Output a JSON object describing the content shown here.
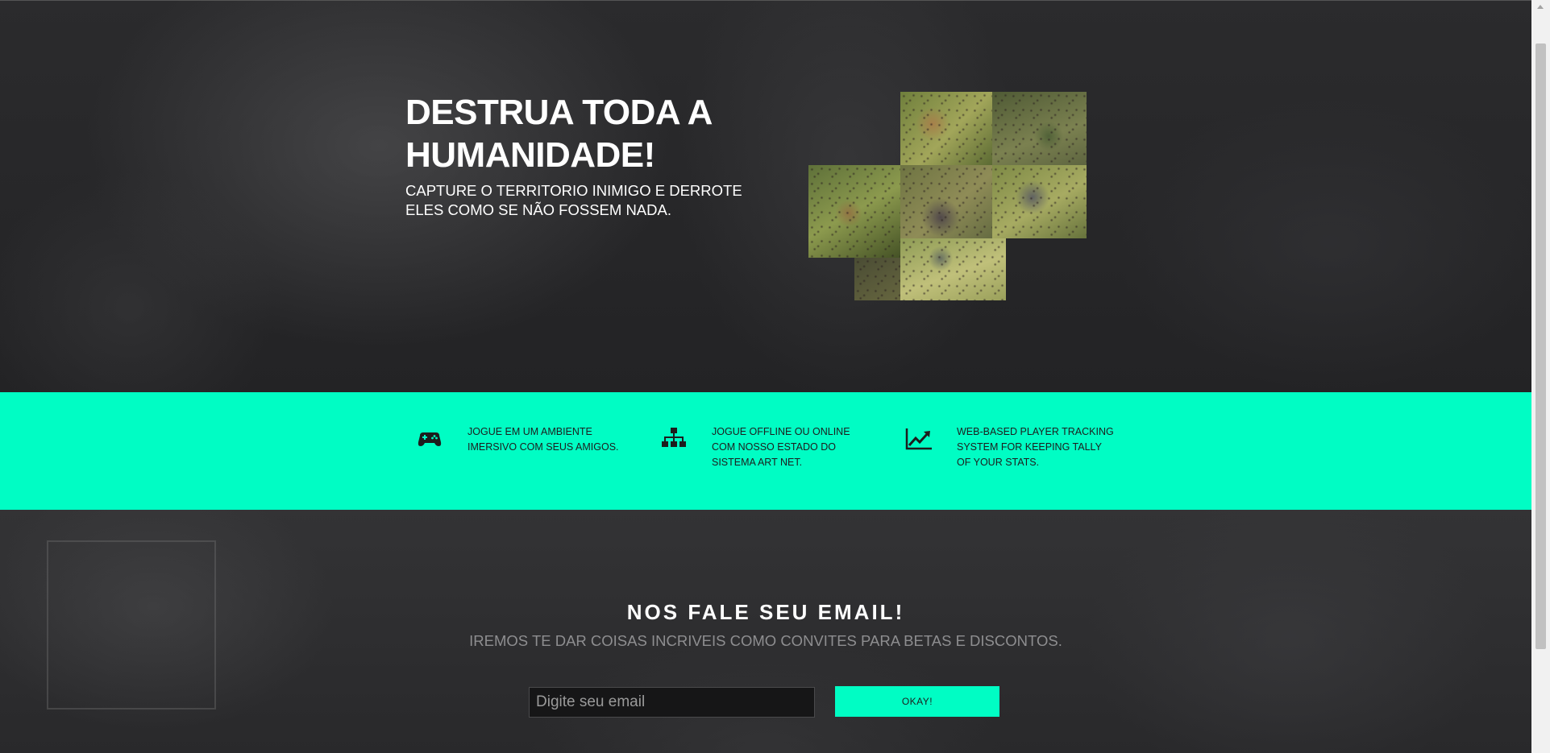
{
  "hero": {
    "title": "DESTRUA TODA A HUMANIDADE!",
    "subtitle": "CAPTURE O TERRITORIO INIMIGO E DERROTE ELES COMO SE NÃO FOSSEM NADA."
  },
  "features": [
    {
      "icon": "gamepad-icon",
      "text": "JOGUE EM UM AMBIENTE IMERSIVO COM SEUS AMIGOS."
    },
    {
      "icon": "sitemap-icon",
      "text": "JOGUE OFFLINE OU ONLINE COM NOSSO ESTADO DO SISTEMA ART NET."
    },
    {
      "icon": "line-chart-icon",
      "text": "WEB-BASED PLAYER TRACKING SYSTEM FOR KEEPING TALLY OF YOUR STATS."
    }
  ],
  "signup": {
    "title": "NOS FALE SEU EMAIL!",
    "subtitle": "IREMOS TE DAR COISAS INCRIVEIS COMO CONVITES PARA BETAS E DISCONTOS.",
    "email_placeholder": "Digite seu email",
    "email_value": "",
    "button_label": "OKAY!"
  },
  "colors": {
    "accent": "#00fdc4",
    "background": "#262628",
    "text_light": "#ffffff",
    "text_muted": "#8e8e90"
  }
}
